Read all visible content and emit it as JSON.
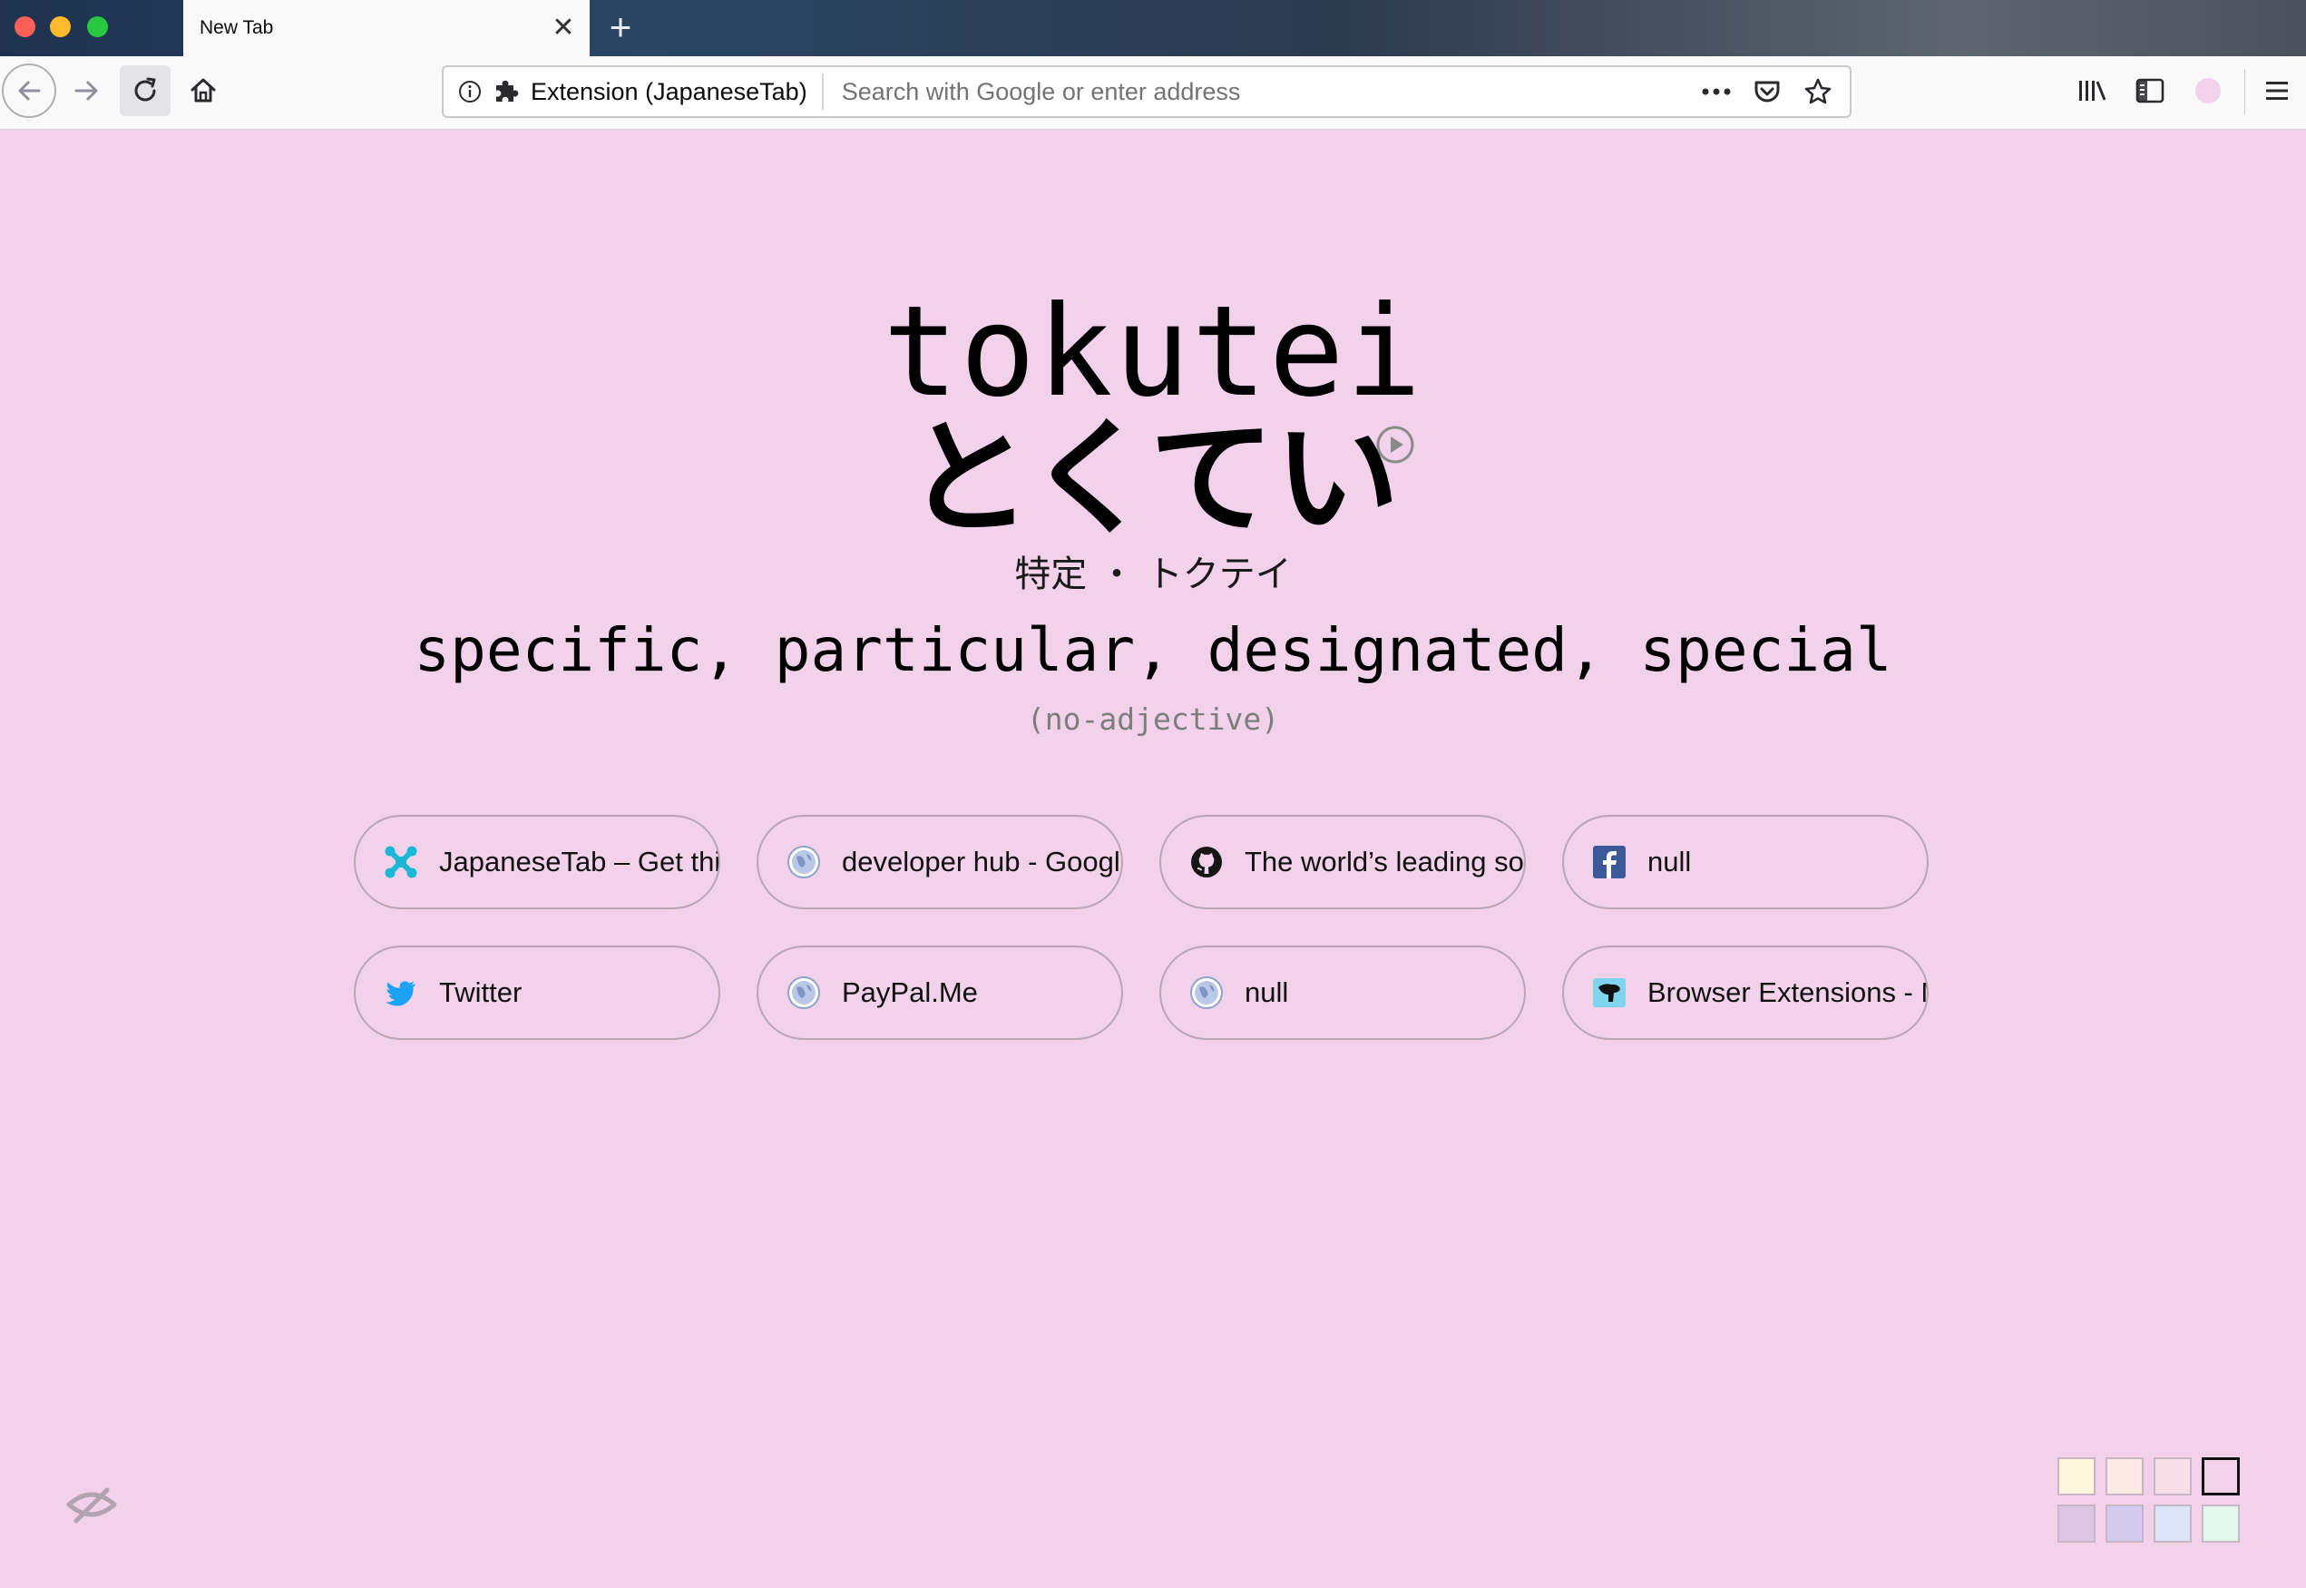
{
  "browser": {
    "tab": {
      "title": "New Tab",
      "close_glyph": "✕"
    },
    "new_tab_glyph": "+",
    "urlbar": {
      "identity_label": "Extension (JapaneseTab)",
      "placeholder": "Search with Google or enter address",
      "value": ""
    },
    "icons": [
      "back-icon",
      "forward-icon",
      "reload-icon",
      "home-icon",
      "info-icon",
      "puzzle-icon",
      "more-icon",
      "pocket-icon",
      "bookmark-star-icon",
      "library-icon",
      "sidebar-icon",
      "extension-dot-icon",
      "hamburger-menu-icon"
    ]
  },
  "word": {
    "romaji": "tokutei",
    "kana": "とくてい",
    "kanji_reading": "特定 ・ トクテイ",
    "meaning": "specific, particular, designated, special",
    "part_of_speech": "(no-adjective)"
  },
  "shortcuts": [
    {
      "label": "JapaneseTab – Get this",
      "icon": "japanesetab-icon"
    },
    {
      "label": "developer hub - Google",
      "icon": "globe-icon"
    },
    {
      "label": "The world’s leading sof",
      "icon": "github-icon"
    },
    {
      "label": "null",
      "icon": "facebook-icon"
    },
    {
      "label": "Twitter",
      "icon": "twitter-icon"
    },
    {
      "label": "PayPal.Me",
      "icon": "globe-icon"
    },
    {
      "label": "null",
      "icon": "globe-icon"
    },
    {
      "label": "Browser Extensions - M",
      "icon": "browser-extensions-icon"
    }
  ],
  "theme_swatches": {
    "colors": [
      "#fdf8dc",
      "#fbe9e4",
      "#f8dfe7",
      "#f2d2ea",
      "#ddc6e4",
      "#d3caf0",
      "#dbe5f8",
      "#e3f7ec"
    ],
    "selected_index": 3
  },
  "page_background": "#f2d2ea"
}
